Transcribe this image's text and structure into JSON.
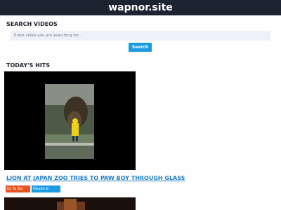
{
  "header": {
    "site_title": "wapnor.site"
  },
  "search": {
    "heading": "SEARCH VIDEOS",
    "placeholder": "Enter video you are searching for...",
    "button_label": "Search"
  },
  "hits": {
    "heading": "TODAY'S HITS",
    "videos": [
      {
        "title": "LION AT JAPAN ZOO TRIES TO PAW BOY THROUGH GLASS",
        "author": "by Tu Bui Anh",
        "category": "People & Blogs"
      }
    ]
  },
  "colors": {
    "header_bg": "#1c2331",
    "accent_blue": "#1e9be0",
    "link_blue": "#1e7dc6",
    "author_tag": "#e8531f"
  }
}
